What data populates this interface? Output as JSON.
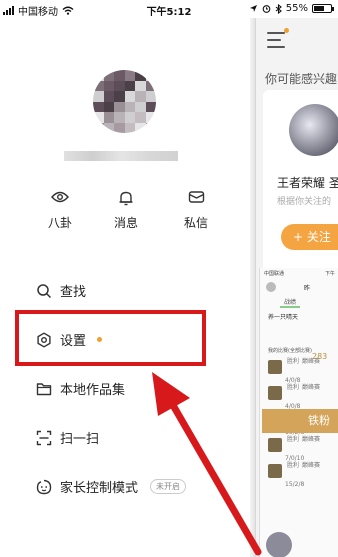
{
  "status_bar": {
    "carrier": "中国移动",
    "time": "下午5:12",
    "battery": "55%"
  },
  "drawer": {
    "quick_actions": [
      {
        "label": "八卦",
        "icon": "eye-icon"
      },
      {
        "label": "消息",
        "icon": "bell-icon"
      },
      {
        "label": "私信",
        "icon": "mail-icon"
      }
    ],
    "menu": [
      {
        "label": "查找",
        "icon": "search-icon"
      },
      {
        "label": "设置",
        "icon": "gear-icon",
        "has_dot": true
      },
      {
        "label": "本地作品集",
        "icon": "folder-icon"
      },
      {
        "label": "扫一扫",
        "icon": "scan-icon"
      },
      {
        "label": "家长控制模式",
        "icon": "parental-icon",
        "badge": "未开启"
      }
    ]
  },
  "background_page": {
    "section_title": "你可能感兴趣",
    "recommend": {
      "name": "王者荣耀 圣",
      "desc": "根据你关注的",
      "follow_label": "+ 关注"
    },
    "embedded": {
      "status_left": "中国联通",
      "status_right": "下午",
      "header_text": "昨",
      "tab": "战绩",
      "game_title": "养一只晴天",
      "score": "283",
      "list_title": "我的比赛(全部比赛)",
      "fans_label": "铁粉",
      "rows": [
        {
          "result": "胜利",
          "mode": "巅峰赛",
          "kda": "4/0/8"
        },
        {
          "result": "胜利",
          "mode": "巅峰赛",
          "kda": "4/0/8"
        },
        {
          "result": "胜利",
          "mode": "巅峰赛",
          "kda": "15/2/8"
        },
        {
          "result": "胜利",
          "mode": "巅峰赛",
          "kda": "7/0/10"
        },
        {
          "result": "胜利",
          "mode": "巅峰赛",
          "kda": "15/2/8"
        }
      ]
    }
  },
  "colors": {
    "accent": "#f0a030",
    "highlight": "#d7191c",
    "follow": "#f5a442"
  }
}
